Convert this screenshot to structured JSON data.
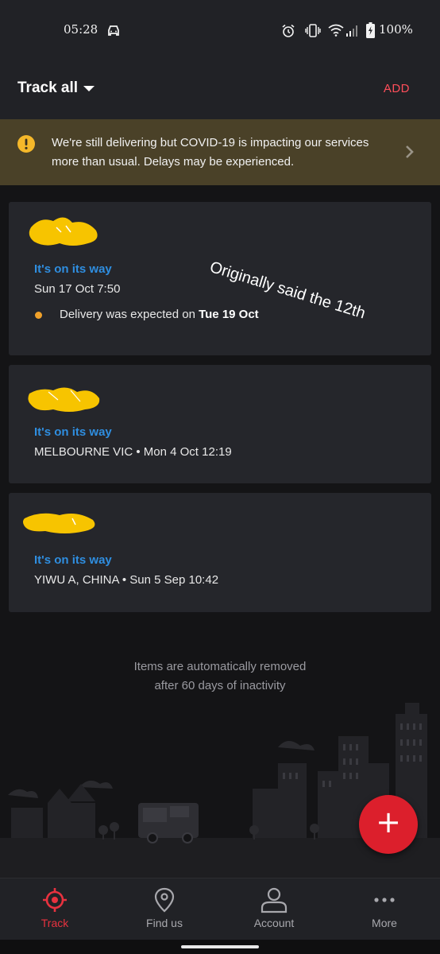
{
  "status_bar": {
    "time": "05:28",
    "battery": "100%",
    "icons": [
      "car-icon",
      "alarm-icon",
      "vibrate-icon",
      "wifi-icon",
      "signal-icon",
      "battery-icon"
    ]
  },
  "header": {
    "title": "Track all",
    "add_label": "ADD"
  },
  "banner": {
    "text": "We're still delivering but COVID-19 is impacting our services more than usual. Delays may be experienced.",
    "icon": "alert-icon",
    "background": "#4a4128"
  },
  "items": [
    {
      "status": "It's on its way",
      "meta": "Sun 17 Oct 7:50",
      "expected_prefix": "Delivery was expected on ",
      "expected_date": "Tue 19 Oct",
      "annotation": "Originally said the 12th"
    },
    {
      "status": "It's on its way",
      "meta": "MELBOURNE VIC • Mon 4 Oct 12:19"
    },
    {
      "status": "It's on its way",
      "meta": "YIWU A, CHINA • Sun 5 Sep 10:42"
    }
  ],
  "footer_note": {
    "line1": "Items are automatically removed",
    "line2": "after 60 days of inactivity"
  },
  "fab": {
    "label": "+"
  },
  "nav": [
    {
      "label": "Track",
      "icon": "target-icon",
      "active": true
    },
    {
      "label": "Find us",
      "icon": "location-pin-icon",
      "active": false
    },
    {
      "label": "Account",
      "icon": "person-icon",
      "active": false
    },
    {
      "label": "More",
      "icon": "more-dots-icon",
      "active": false
    }
  ],
  "colors": {
    "accent": "#dc1f2c",
    "status_blue": "#2f8ee0",
    "dot_orange": "#f0a12a",
    "redaction_yellow": "#f7c400"
  }
}
